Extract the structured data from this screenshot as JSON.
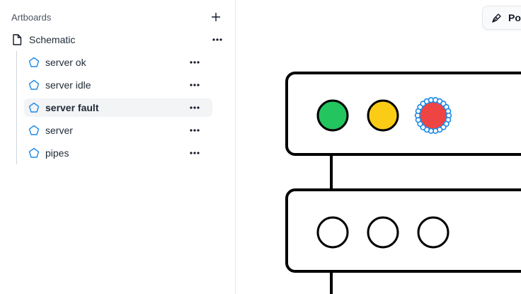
{
  "sidebar": {
    "title": "Artboards",
    "add_icon": "plus-icon",
    "file": {
      "label": "Schematic",
      "icon": "file-icon"
    },
    "items": [
      {
        "label": "server ok",
        "icon": "pentagon-icon",
        "selected": false
      },
      {
        "label": "server idle",
        "icon": "pentagon-icon",
        "selected": false
      },
      {
        "label": "server fault",
        "icon": "pentagon-icon",
        "selected": true
      },
      {
        "label": "server",
        "icon": "pentagon-icon",
        "selected": false
      },
      {
        "label": "pipes",
        "icon": "pentagon-icon",
        "selected": false
      }
    ]
  },
  "canvas": {
    "tool_button": {
      "label": "Pol",
      "icon": "pen-icon"
    },
    "lights_top": [
      {
        "color": "#22c55e",
        "selected": false
      },
      {
        "color": "#facc15",
        "selected": false
      },
      {
        "color": "#ef4444",
        "selected": true
      }
    ],
    "lights_bottom": [
      {
        "color": "#ffffff"
      },
      {
        "color": "#ffffff"
      },
      {
        "color": "#ffffff"
      }
    ],
    "selection_color": "#1e88e5"
  }
}
